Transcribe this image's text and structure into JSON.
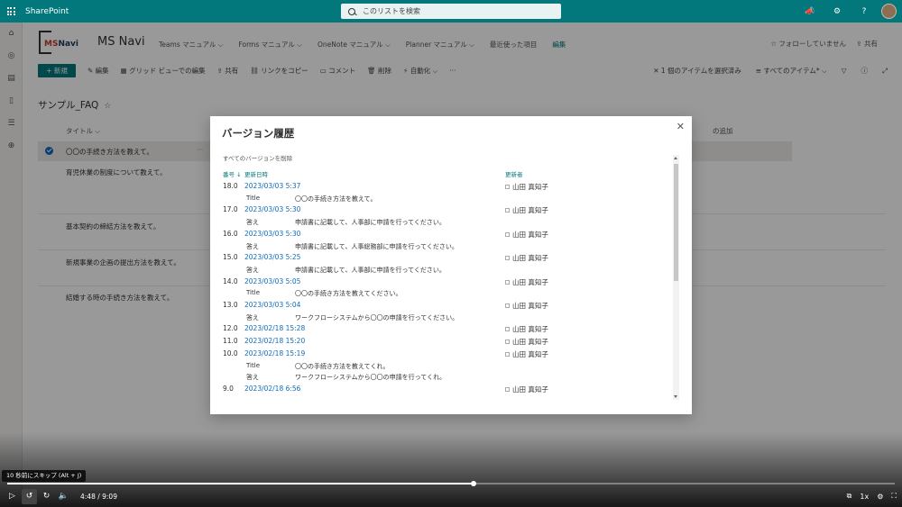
{
  "suite": {
    "brand": "SharePoint",
    "search_placeholder": "このリストを検索"
  },
  "site": {
    "logo_text_ms": "MS",
    "logo_text_navi": "Navi",
    "title": "MS Navi",
    "nav": [
      "Teams マニュアル ⌵",
      "Forms マニュアル ⌵",
      "OneNote マニュアル ⌵",
      "Planner マニュアル ⌵",
      "最近使った項目",
      "編集"
    ],
    "follow": "☆ フォローしていません",
    "share": "⇪ 共有"
  },
  "commands": {
    "new": "+ 新規",
    "items": [
      "✎ 編集",
      "▦ グリッド ビューでの編集",
      "⇪ 共有",
      "⛓ リンクをコピー",
      "▭ コメント",
      "🗑 削除",
      "⚡ 自動化 ⌵",
      "···"
    ],
    "selected": "✕ 1 個のアイテムを選択済み",
    "view": "≡ すべてのアイテム* ⌵"
  },
  "list": {
    "title": "サンプル_FAQ",
    "star": "☆",
    "col_title": "タイトル ⌵",
    "add_col": "の追加",
    "more": "···",
    "rows": [
      "〇〇の手続き方法を教えて。",
      "育児休業の制度について教えて。",
      "基本契約の締結方法を教えて。",
      "新規事業の企画の提出方法を教えて。",
      "結婚する時の手続き方法を教えて。"
    ]
  },
  "dialog": {
    "title": "バージョン履歴",
    "close": "✕",
    "delete_all": "すべてのバージョンを削除",
    "headers": {
      "num": "番号 ↓",
      "date": "更新日時",
      "modified_by": "更新者"
    },
    "versions": [
      {
        "num": "18.0",
        "date": "2023/03/03 5:37",
        "by": "山田 真知子",
        "changes": [
          {
            "k": "Title",
            "v": "〇〇の手続き方法を教えて。"
          }
        ]
      },
      {
        "num": "17.0",
        "date": "2023/03/03 5:30",
        "by": "山田 真知子",
        "changes": [
          {
            "k": "答え",
            "v": "申請書に記載して、人事部に申請を行ってください。"
          }
        ]
      },
      {
        "num": "16.0",
        "date": "2023/03/03 5:30",
        "by": "山田 真知子",
        "changes": [
          {
            "k": "答え",
            "v": "申請書に記載して、人事総務部に申請を行ってください。"
          }
        ]
      },
      {
        "num": "15.0",
        "date": "2023/03/03 5:25",
        "by": "山田 真知子",
        "changes": [
          {
            "k": "答え",
            "v": "申請書に記載して、人事部に申請を行ってください。"
          }
        ]
      },
      {
        "num": "14.0",
        "date": "2023/03/03 5:05",
        "by": "山田 真知子",
        "changes": [
          {
            "k": "Title",
            "v": "〇〇の手続き方法を教えてください。"
          }
        ]
      },
      {
        "num": "13.0",
        "date": "2023/03/03 5:04",
        "by": "山田 真知子",
        "changes": [
          {
            "k": "答え",
            "v": "ワークフローシステムから〇〇の申請を行ってください。"
          }
        ]
      },
      {
        "num": "12.0",
        "date": "2023/02/18 15:28",
        "by": "山田 真知子",
        "changes": []
      },
      {
        "num": "11.0",
        "date": "2023/02/18 15:20",
        "by": "山田 真知子",
        "changes": []
      },
      {
        "num": "10.0",
        "date": "2023/02/18 15:19",
        "by": "山田 真知子",
        "changes": [
          {
            "k": "Title",
            "v": "〇〇の手続き方法を教えてくれ。"
          },
          {
            "k": "答え",
            "v": "ワークフローシステムから〇〇の申請を行ってくれ。"
          }
        ]
      },
      {
        "num": "9.0",
        "date": "2023/02/18 6:56",
        "by": "山田 真知子",
        "changes": []
      }
    ]
  },
  "player": {
    "tooltip": "10 秒前にスキップ (Alt + J)",
    "time": "4:48 / 9:09",
    "progress": 0.525,
    "speed": "1x",
    "icons": [
      "play-icon",
      "skip-back-icon",
      "skip-forward-icon",
      "volume-icon",
      "picture-in-picture-icon",
      "settings-icon",
      "fullscreen-icon"
    ]
  }
}
